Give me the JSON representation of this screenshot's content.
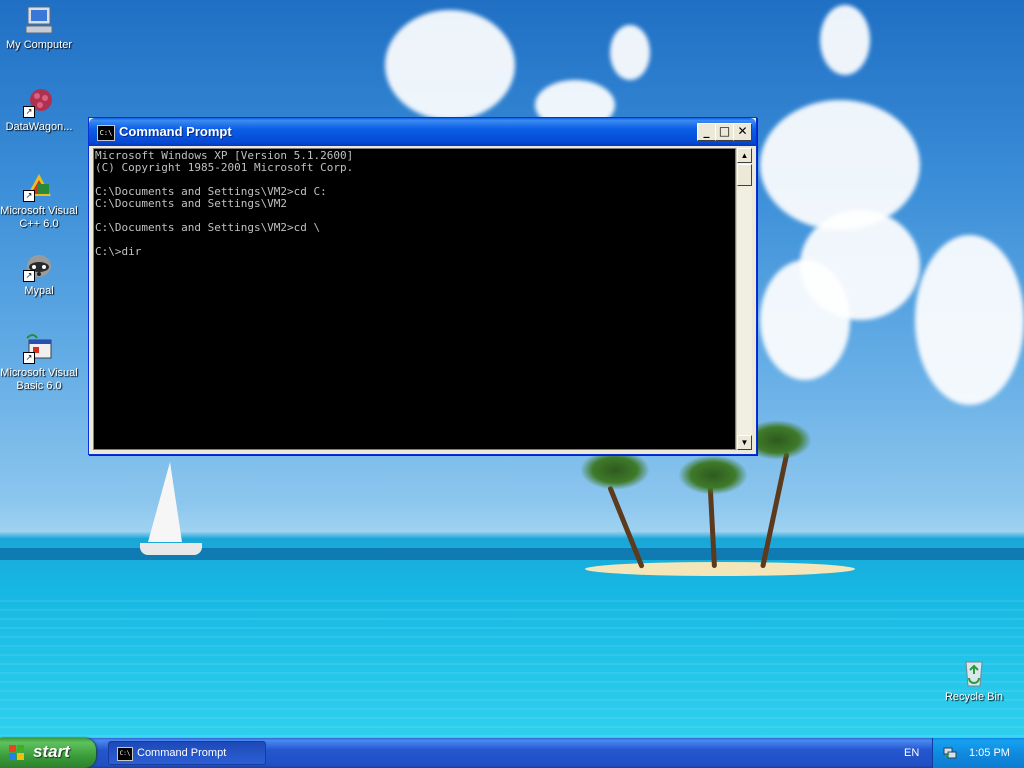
{
  "desktop": {
    "icons": [
      {
        "label": "My Computer",
        "icon": "my-computer-icon"
      },
      {
        "label": "DataWagon...",
        "icon": "datawagon-icon"
      },
      {
        "label": "Microsoft Visual C++ 6.0",
        "icon": "visual-cpp-icon"
      },
      {
        "label": "Mypal",
        "icon": "mypal-raccoon-icon"
      },
      {
        "label": "Microsoft Visual Basic 6.0",
        "icon": "visual-basic-icon"
      },
      {
        "label": "Recycle Bin",
        "icon": "recycle-bin-icon"
      }
    ]
  },
  "cmd_window": {
    "title": "Command Prompt",
    "title_icon_text": "C:\\",
    "controls": {
      "minimize": "_",
      "maximize": "□",
      "close": "✕"
    },
    "output": "Microsoft Windows XP [Version 5.1.2600]\n(C) Copyright 1985-2001 Microsoft Corp.\n\nC:\\Documents and Settings\\VM2>cd C:\nC:\\Documents and Settings\\VM2\n\nC:\\Documents and Settings\\VM2>cd \\\n\nC:\\>dir",
    "scroll_up": "▲",
    "scroll_down": "▼"
  },
  "taskbar": {
    "start_label": "start",
    "tasks": [
      {
        "label": "Command Prompt",
        "icon_text": "C:\\"
      }
    ],
    "language": "EN",
    "clock": "1:05 PM"
  },
  "colors": {
    "title_bar": "#0a5fe6",
    "console_bg": "#000000",
    "console_text": "#c0c0c0",
    "taskbar": "#2456cf",
    "start_button": "#3a9c3a",
    "tray": "#0f8be0"
  }
}
